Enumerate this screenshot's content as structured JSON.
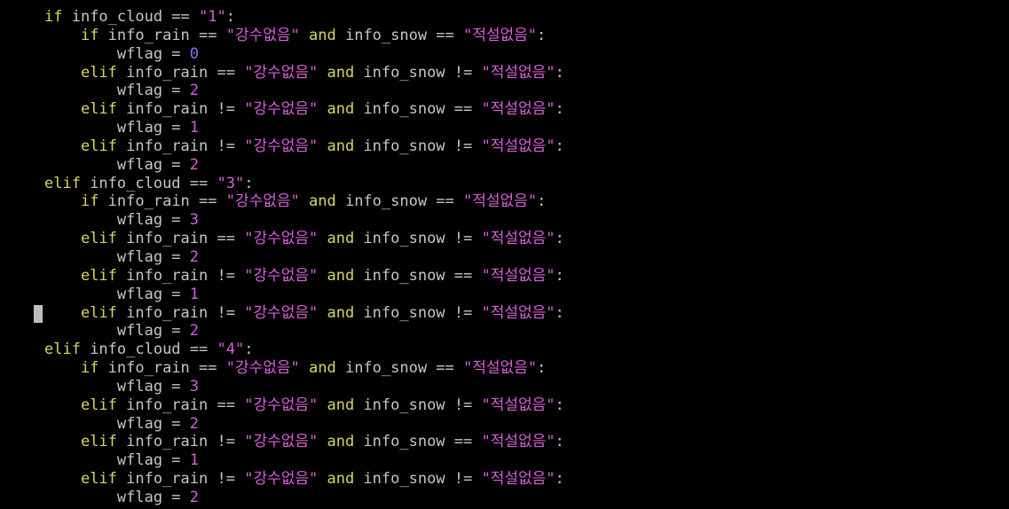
{
  "terminal": {
    "colors": {
      "background": "#000000",
      "keyword": "#d7d75f",
      "identifier": "#c6c6c6",
      "string": "#d75fd7",
      "number": "#d75fd7"
    },
    "cursor_line": 16,
    "lines": [
      {
        "indent": 0,
        "tokens": [
          [
            "kw",
            "if"
          ],
          [
            "id",
            " info_cloud == "
          ],
          [
            "str",
            "\"1\""
          ],
          [
            "id",
            ":"
          ]
        ]
      },
      {
        "indent": 1,
        "tokens": [
          [
            "kw",
            "if"
          ],
          [
            "id",
            " info_rain == "
          ],
          [
            "str",
            "\"강수없음\""
          ],
          [
            "kw",
            " and"
          ],
          [
            "id",
            " info_snow == "
          ],
          [
            "str",
            "\"적설없음\""
          ],
          [
            "id",
            ":"
          ]
        ]
      },
      {
        "indent": 2,
        "tokens": [
          [
            "id",
            "wflag = "
          ],
          [
            "num0",
            "0"
          ]
        ]
      },
      {
        "indent": 1,
        "tokens": [
          [
            "kw",
            "elif"
          ],
          [
            "id",
            " info_rain == "
          ],
          [
            "str",
            "\"강수없음\""
          ],
          [
            "kw",
            " and"
          ],
          [
            "id",
            " info_snow != "
          ],
          [
            "str",
            "\"적설없음\""
          ],
          [
            "id",
            ":"
          ]
        ]
      },
      {
        "indent": 2,
        "tokens": [
          [
            "id",
            "wflag = "
          ],
          [
            "num",
            "2"
          ]
        ]
      },
      {
        "indent": 1,
        "tokens": [
          [
            "kw",
            "elif"
          ],
          [
            "id",
            " info_rain != "
          ],
          [
            "str",
            "\"강수없음\""
          ],
          [
            "kw",
            " and"
          ],
          [
            "id",
            " info_snow == "
          ],
          [
            "str",
            "\"적설없음\""
          ],
          [
            "id",
            ":"
          ]
        ]
      },
      {
        "indent": 2,
        "tokens": [
          [
            "id",
            "wflag = "
          ],
          [
            "num",
            "1"
          ]
        ]
      },
      {
        "indent": 1,
        "tokens": [
          [
            "kw",
            "elif"
          ],
          [
            "id",
            " info_rain != "
          ],
          [
            "str",
            "\"강수없음\""
          ],
          [
            "kw",
            " and"
          ],
          [
            "id",
            " info_snow != "
          ],
          [
            "str",
            "\"적설없음\""
          ],
          [
            "id",
            ":"
          ]
        ]
      },
      {
        "indent": 2,
        "tokens": [
          [
            "id",
            "wflag = "
          ],
          [
            "num",
            "2"
          ]
        ]
      },
      {
        "indent": 0,
        "tokens": [
          [
            "kw",
            "elif"
          ],
          [
            "id",
            " info_cloud == "
          ],
          [
            "str",
            "\"3\""
          ],
          [
            "id",
            ":"
          ]
        ]
      },
      {
        "indent": 1,
        "tokens": [
          [
            "kw",
            "if"
          ],
          [
            "id",
            " info_rain == "
          ],
          [
            "str",
            "\"강수없음\""
          ],
          [
            "kw",
            " and"
          ],
          [
            "id",
            " info_snow == "
          ],
          [
            "str",
            "\"적설없음\""
          ],
          [
            "id",
            ":"
          ]
        ]
      },
      {
        "indent": 2,
        "tokens": [
          [
            "id",
            "wflag = "
          ],
          [
            "num",
            "3"
          ]
        ]
      },
      {
        "indent": 1,
        "tokens": [
          [
            "kw",
            "elif"
          ],
          [
            "id",
            " info_rain == "
          ],
          [
            "str",
            "\"강수없음\""
          ],
          [
            "kw",
            " and"
          ],
          [
            "id",
            " info_snow != "
          ],
          [
            "str",
            "\"적설없음\""
          ],
          [
            "id",
            ":"
          ]
        ]
      },
      {
        "indent": 2,
        "tokens": [
          [
            "id",
            "wflag = "
          ],
          [
            "num",
            "2"
          ]
        ]
      },
      {
        "indent": 1,
        "tokens": [
          [
            "kw",
            "elif"
          ],
          [
            "id",
            " info_rain != "
          ],
          [
            "str",
            "\"강수없음\""
          ],
          [
            "kw",
            " and"
          ],
          [
            "id",
            " info_snow == "
          ],
          [
            "str",
            "\"적설없음\""
          ],
          [
            "id",
            ":"
          ]
        ]
      },
      {
        "indent": 2,
        "tokens": [
          [
            "id",
            "wflag = "
          ],
          [
            "num",
            "1"
          ]
        ]
      },
      {
        "indent": 1,
        "tokens": [
          [
            "kw",
            "elif"
          ],
          [
            "id",
            " info_rain != "
          ],
          [
            "str",
            "\"강수없음\""
          ],
          [
            "kw",
            " and"
          ],
          [
            "id",
            " info_snow != "
          ],
          [
            "str",
            "\"적설없음\""
          ],
          [
            "id",
            ":"
          ]
        ]
      },
      {
        "indent": 2,
        "tokens": [
          [
            "id",
            "wflag = "
          ],
          [
            "num",
            "2"
          ]
        ]
      },
      {
        "indent": 0,
        "tokens": [
          [
            "kw",
            "elif"
          ],
          [
            "id",
            " info_cloud == "
          ],
          [
            "str",
            "\"4\""
          ],
          [
            "id",
            ":"
          ]
        ]
      },
      {
        "indent": 1,
        "tokens": [
          [
            "kw",
            "if"
          ],
          [
            "id",
            " info_rain == "
          ],
          [
            "str",
            "\"강수없음\""
          ],
          [
            "kw",
            " and"
          ],
          [
            "id",
            " info_snow == "
          ],
          [
            "str",
            "\"적설없음\""
          ],
          [
            "id",
            ":"
          ]
        ]
      },
      {
        "indent": 2,
        "tokens": [
          [
            "id",
            "wflag = "
          ],
          [
            "num",
            "3"
          ]
        ]
      },
      {
        "indent": 1,
        "tokens": [
          [
            "kw",
            "elif"
          ],
          [
            "id",
            " info_rain == "
          ],
          [
            "str",
            "\"강수없음\""
          ],
          [
            "kw",
            " and"
          ],
          [
            "id",
            " info_snow != "
          ],
          [
            "str",
            "\"적설없음\""
          ],
          [
            "id",
            ":"
          ]
        ]
      },
      {
        "indent": 2,
        "tokens": [
          [
            "id",
            "wflag = "
          ],
          [
            "num",
            "2"
          ]
        ]
      },
      {
        "indent": 1,
        "tokens": [
          [
            "kw",
            "elif"
          ],
          [
            "id",
            " info_rain != "
          ],
          [
            "str",
            "\"강수없음\""
          ],
          [
            "kw",
            " and"
          ],
          [
            "id",
            " info_snow == "
          ],
          [
            "str",
            "\"적설없음\""
          ],
          [
            "id",
            ":"
          ]
        ]
      },
      {
        "indent": 2,
        "tokens": [
          [
            "id",
            "wflag = "
          ],
          [
            "num",
            "1"
          ]
        ]
      },
      {
        "indent": 1,
        "tokens": [
          [
            "kw",
            "elif"
          ],
          [
            "id",
            " info_rain != "
          ],
          [
            "str",
            "\"강수없음\""
          ],
          [
            "kw",
            " and"
          ],
          [
            "id",
            " info_snow != "
          ],
          [
            "str",
            "\"적설없음\""
          ],
          [
            "id",
            ":"
          ]
        ]
      },
      {
        "indent": 2,
        "tokens": [
          [
            "id",
            "wflag = "
          ],
          [
            "num",
            "2"
          ]
        ]
      }
    ]
  }
}
